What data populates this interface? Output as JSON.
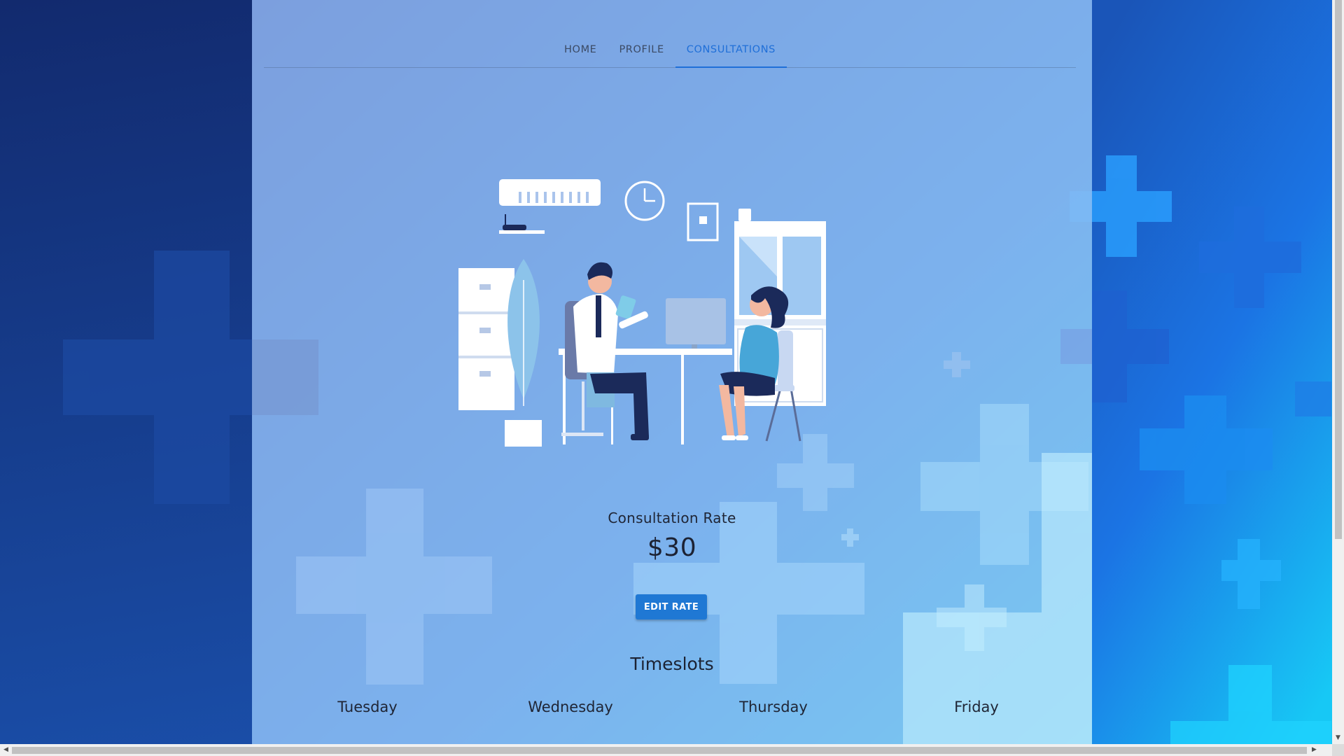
{
  "nav": {
    "tabs": [
      {
        "label": "HOME"
      },
      {
        "label": "PROFILE"
      },
      {
        "label": "CONSULTATIONS"
      }
    ],
    "active_tab": "CONSULTATIONS"
  },
  "consultation": {
    "rate_label": "Consultation Rate",
    "rate_value": "$30",
    "edit_button": "EDIT RATE"
  },
  "timeslots": {
    "title": "Timeslots",
    "days": [
      "Tuesday",
      "Wednesday",
      "Thursday",
      "Friday"
    ]
  },
  "colors": {
    "accent": "#1f78d4",
    "active_tab": "#1f6fd8",
    "background_dark": "#0f2f7a",
    "background_bright": "#17d0f5"
  },
  "icons": {
    "illustration": "doctor-consultation-illustration",
    "scroll_left": "arrow-left-icon",
    "scroll_right": "arrow-right-icon",
    "scroll_down": "arrow-down-icon"
  }
}
